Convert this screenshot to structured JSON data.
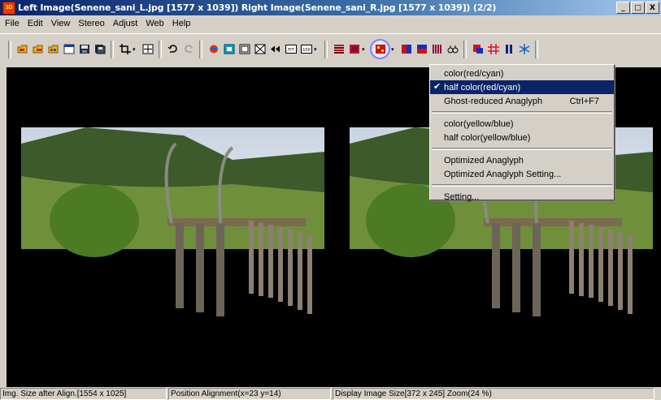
{
  "window": {
    "title": "Left Image(Senene_sani_L.jpg [1577 x 1039]) Right Image(Senene_sani_R.jpg [1577 x 1039])  (2/2)",
    "app_icon_text": "3D",
    "controls": [
      "_",
      "□",
      "X"
    ]
  },
  "menu": [
    "File",
    "Edit",
    "View",
    "Stereo",
    "Adjust",
    "Web",
    "Help"
  ],
  "dropdown": {
    "items": [
      {
        "label": "color(red/cyan)",
        "selected": false
      },
      {
        "label": "half color(red/cyan)",
        "selected": true,
        "check": "✔"
      },
      {
        "label": "Ghost-reduced Anaglyph",
        "shortcut": "Ctrl+F7"
      },
      {
        "label": "color(yellow/blue)"
      },
      {
        "label": "half color(yellow/blue)"
      },
      {
        "label": "Optimized Anaglyph"
      },
      {
        "label": "Optimized Anaglyph Setting..."
      },
      {
        "label": "Setting..."
      }
    ]
  },
  "status": {
    "align_size": "Img. Size after Align.[1554 x 1025]",
    "position_alignment": "Position Alignment(x=23 y=14)",
    "display_size": "Display Image Size[372 x 245]  Zoom(24 %)"
  },
  "toolbar_labels": {
    "fit": "FIT",
    "hundred": "100"
  }
}
